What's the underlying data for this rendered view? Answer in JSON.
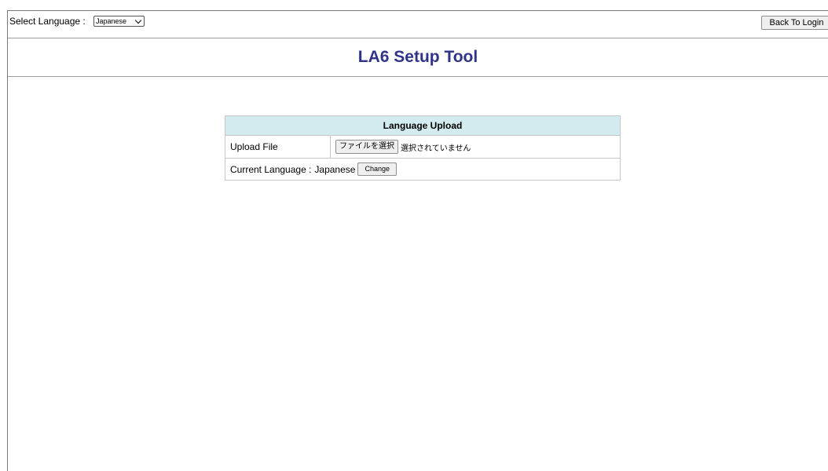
{
  "topbar": {
    "language_label": "Select Language :",
    "language_selected": "Japanese",
    "back_button": "Back To Login"
  },
  "header": {
    "title": "LA6 Setup Tool"
  },
  "panel": {
    "heading": "Language Upload",
    "upload_label": "Upload File",
    "file_button": "ファイルを選択",
    "file_status": "選択されていません",
    "current_language_label": "Current Language :",
    "current_language_value": "Japanese",
    "change_button": "Change"
  },
  "colors": {
    "title": "#2f3488",
    "panel_header_bg": "#d3ecef"
  }
}
